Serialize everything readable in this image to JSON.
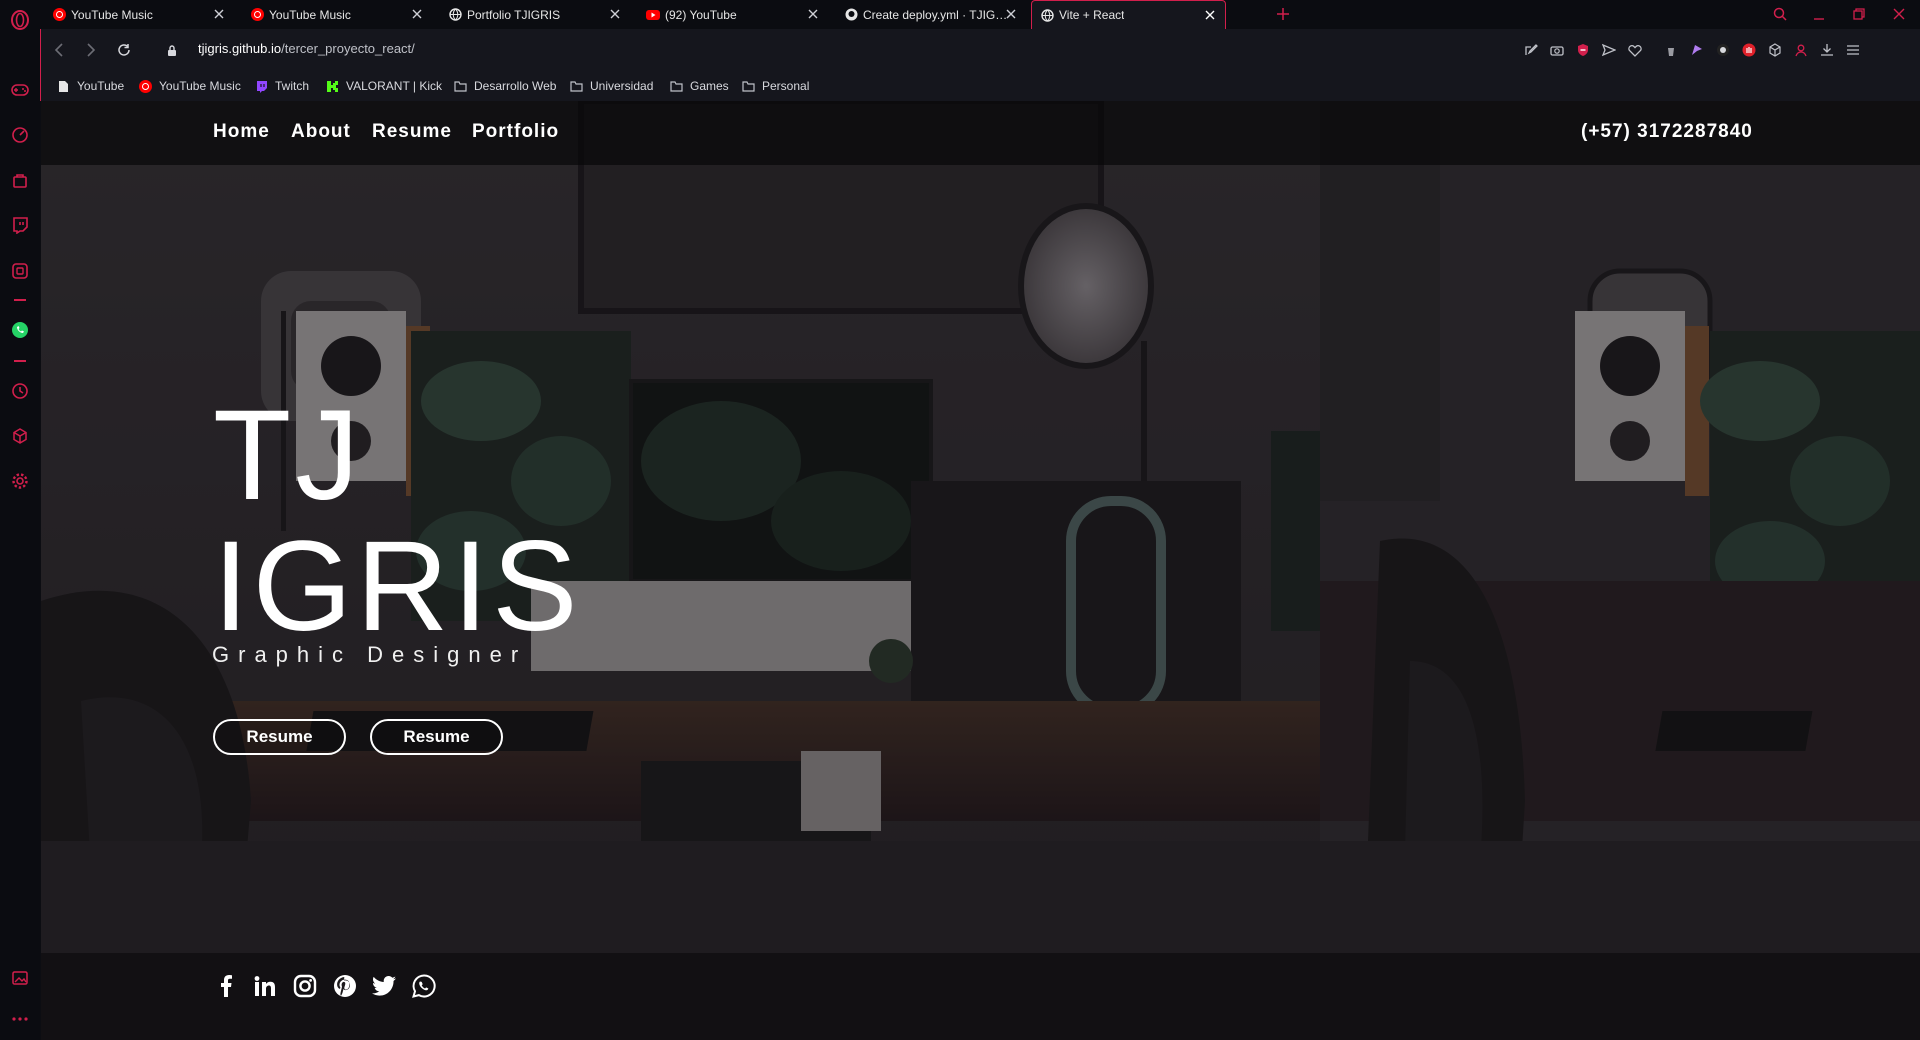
{
  "browser": {
    "tabs": [
      {
        "title": "YouTube Music",
        "favicon": "youtube-music-icon"
      },
      {
        "title": "YouTube Music",
        "favicon": "youtube-music-icon"
      },
      {
        "title": "Portfolio TJIGRIS",
        "favicon": "globe-icon"
      },
      {
        "title": "(92) YouTube",
        "favicon": "youtube-icon"
      },
      {
        "title": "Create deploy.yml · TJIGRIS",
        "favicon": "github-icon"
      },
      {
        "title": "Vite + React",
        "favicon": "globe-icon"
      }
    ],
    "active_tab_index": 5,
    "url_domain": "tjigris.github.io",
    "url_path": "/tercer_proyecto_react/",
    "accent_color": "#d21f4c",
    "bookmarks": [
      {
        "label": "YouTube",
        "icon": "page-icon"
      },
      {
        "label": "YouTube Music",
        "icon": "youtube-music-icon"
      },
      {
        "label": "Twitch",
        "icon": "twitch-icon"
      },
      {
        "label": "VALORANT | Kick",
        "icon": "kick-icon"
      },
      {
        "label": "Desarrollo Web",
        "icon": "folder-icon"
      },
      {
        "label": "Universidad",
        "icon": "folder-icon"
      },
      {
        "label": "Games",
        "icon": "folder-icon"
      },
      {
        "label": "Personal",
        "icon": "folder-icon"
      }
    ]
  },
  "site": {
    "nav": [
      "Home",
      "About",
      "Resume",
      "Portfolio"
    ],
    "phone": "(+57) 3172287840",
    "hero_line1": "TJ",
    "hero_line2": "IGRIS",
    "subtitle": "Graphic Designer",
    "buttons": [
      "Resume",
      "Resume"
    ],
    "social": [
      "facebook-icon",
      "linkedin-icon",
      "instagram-icon",
      "pinterest-icon",
      "twitter-icon",
      "whatsapp-icon"
    ]
  }
}
